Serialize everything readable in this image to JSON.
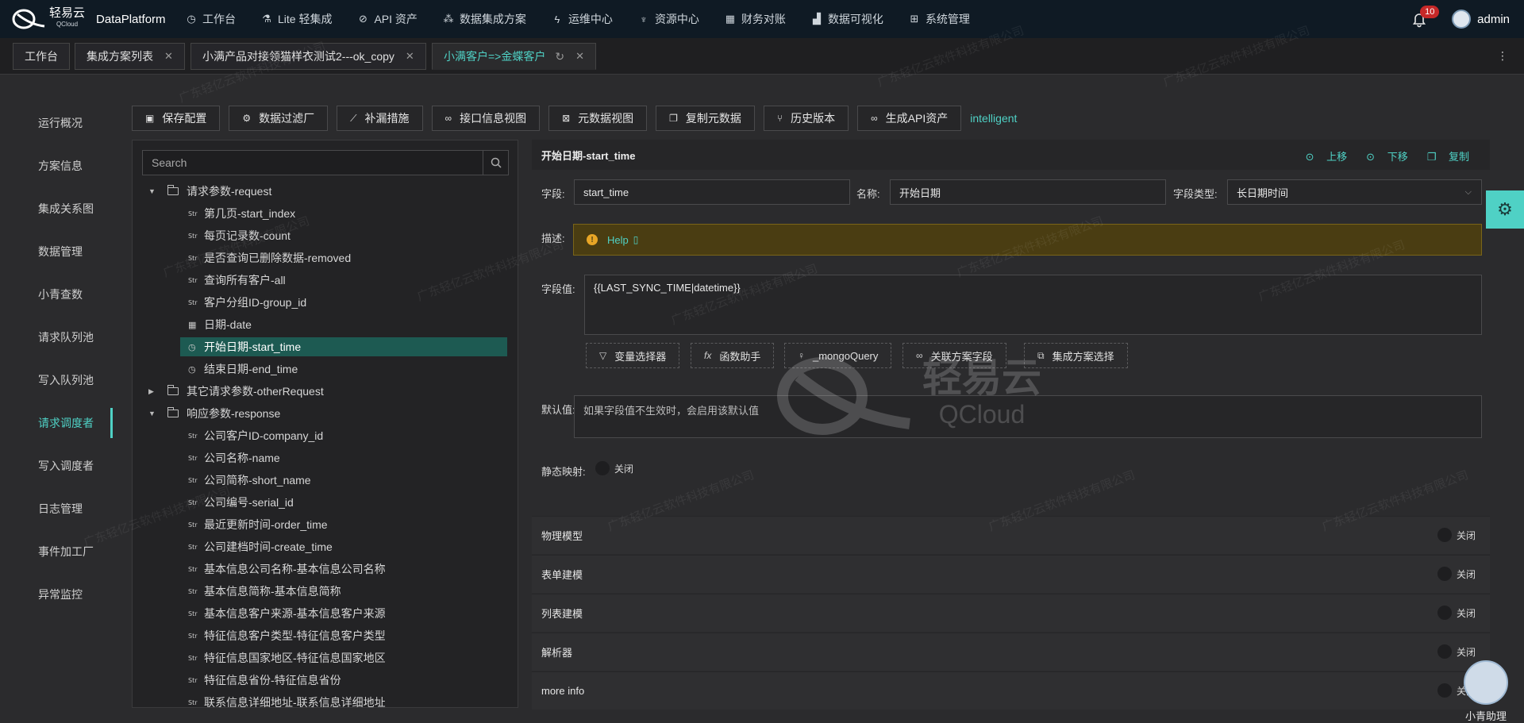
{
  "header": {
    "brand_cn": "轻易云",
    "brand_en": "QCloud",
    "app_name": "DataPlatform",
    "nav": [
      {
        "label": "工作台",
        "icon": "clock-icon"
      },
      {
        "label": "Lite 轻集成",
        "icon": "flask-icon"
      },
      {
        "label": "API 资产",
        "icon": "compass-icon"
      },
      {
        "label": "数据集成方案",
        "icon": "network-icon"
      },
      {
        "label": "运维中心",
        "icon": "bolt-icon"
      },
      {
        "label": "资源中心",
        "icon": "hierarchy-icon"
      },
      {
        "label": "财务对账",
        "icon": "calculator-icon"
      },
      {
        "label": "数据可视化",
        "icon": "chart-icon"
      },
      {
        "label": "系统管理",
        "icon": "grid-icon"
      }
    ],
    "notifications": "10",
    "user": "admin"
  },
  "tabs": [
    {
      "label": "工作台",
      "closable": false
    },
    {
      "label": "集成方案列表",
      "closable": true
    },
    {
      "label": "小满产品对接领猫样衣测试2---ok_copy",
      "closable": true
    },
    {
      "label": "小满客户=>金蝶客户",
      "closable": true,
      "active": true
    }
  ],
  "tab_more": "⋮",
  "sidebar": {
    "items": [
      "运行概况",
      "方案信息",
      "集成关系图",
      "数据管理",
      "小青查数",
      "请求队列池",
      "写入队列池",
      "请求调度者",
      "写入调度者",
      "日志管理",
      "事件加工厂",
      "异常监控"
    ],
    "active": "请求调度者"
  },
  "toolbar": {
    "buttons": [
      {
        "label": "保存配置",
        "icon": "save-icon"
      },
      {
        "label": "数据过滤厂",
        "icon": "gear-icon"
      },
      {
        "label": "补漏措施",
        "icon": "line-chart-icon"
      },
      {
        "label": "接口信息视图",
        "icon": "link-icon"
      },
      {
        "label": "元数据视图",
        "icon": "terminal-icon"
      },
      {
        "label": "复制元数据",
        "icon": "copy-icon"
      },
      {
        "label": "历史版本",
        "icon": "branch-icon"
      },
      {
        "label": "生成API资产",
        "icon": "link-icon"
      }
    ],
    "mode": "intelligent"
  },
  "tree": {
    "search_placeholder": "Search",
    "nodes": [
      {
        "label": "请求参数-request",
        "kind": "folder",
        "expanded": true,
        "level": 0
      },
      {
        "label": "第几页-start_index",
        "kind": "Str",
        "level": 1
      },
      {
        "label": "每页记录数-count",
        "kind": "Str",
        "level": 1
      },
      {
        "label": "是否查询已删除数据-removed",
        "kind": "Str",
        "level": 1
      },
      {
        "label": "查询所有客户-all",
        "kind": "Str",
        "level": 1
      },
      {
        "label": "客户分组ID-group_id",
        "kind": "Str",
        "level": 1
      },
      {
        "label": "日期-date",
        "kind": "date",
        "level": 1
      },
      {
        "label": "开始日期-start_time",
        "kind": "datetime",
        "level": 1,
        "selected": true
      },
      {
        "label": "结束日期-end_time",
        "kind": "datetime",
        "level": 1
      },
      {
        "label": "其它请求参数-otherRequest",
        "kind": "folder",
        "expanded": false,
        "level": 0
      },
      {
        "label": "响应参数-response",
        "kind": "folder",
        "expanded": true,
        "level": 0
      },
      {
        "label": "公司客户ID-company_id",
        "kind": "Str",
        "level": 1
      },
      {
        "label": "公司名称-name",
        "kind": "Str",
        "level": 1
      },
      {
        "label": "公司简称-short_name",
        "kind": "Str",
        "level": 1
      },
      {
        "label": "公司编号-serial_id",
        "kind": "Str",
        "level": 1
      },
      {
        "label": "最近更新时间-order_time",
        "kind": "Str",
        "level": 1
      },
      {
        "label": "公司建档时间-create_time",
        "kind": "Str",
        "level": 1
      },
      {
        "label": "基本信息公司名称-基本信息公司名称",
        "kind": "Str",
        "level": 1
      },
      {
        "label": "基本信息简称-基本信息简称",
        "kind": "Str",
        "level": 1
      },
      {
        "label": "基本信息客户来源-基本信息客户来源",
        "kind": "Str",
        "level": 1
      },
      {
        "label": "特征信息客户类型-特征信息客户类型",
        "kind": "Str",
        "level": 1
      },
      {
        "label": "特征信息国家地区-特征信息国家地区",
        "kind": "Str",
        "level": 1
      },
      {
        "label": "特征信息省份-特征信息省份",
        "kind": "Str",
        "level": 1
      },
      {
        "label": "联系信息详细地址-联系信息详细地址",
        "kind": "Str",
        "level": 1
      }
    ]
  },
  "detail": {
    "title": "开始日期-start_time",
    "actions": {
      "up": "上移",
      "down": "下移",
      "copy": "复制"
    },
    "field_label": "字段:",
    "field_value": "start_time",
    "name_label": "名称:",
    "name_value": "开始日期",
    "type_label": "字段类型:",
    "type_value": "长日期时间",
    "desc_label": "描述:",
    "help_text": "Help",
    "value_label": "字段值:",
    "value_text": "{{LAST_SYNC_TIME|datetime}}",
    "value_buttons": [
      {
        "label": "变量选择器",
        "icon": "filter-icon"
      },
      {
        "label": "函数助手",
        "icon": "fx-icon"
      },
      {
        "label": "_mongoQuery",
        "icon": "bulb-icon"
      },
      {
        "label": "关联方案字段",
        "icon": "link-icon"
      },
      {
        "label": "集成方案选择",
        "icon": "stack-icon"
      }
    ],
    "default_label": "默认值:",
    "default_placeholder": "如果字段值不生效时，会启用该默认值",
    "static_label": "静态映射:",
    "static_state": "关闭"
  },
  "accordions": [
    {
      "title": "物理模型",
      "state": "关闭"
    },
    {
      "title": "表单建模",
      "state": "关闭"
    },
    {
      "title": "列表建模",
      "state": "关闭"
    },
    {
      "title": "解析器",
      "state": "关闭"
    },
    {
      "title": "more info",
      "state": "关闭"
    }
  ],
  "assistant": {
    "label": "小青助理"
  },
  "watermark": {
    "text": "广东轻亿云软件科技有限公司",
    "logo_cn": "轻易云",
    "logo_en": "QCloud"
  }
}
